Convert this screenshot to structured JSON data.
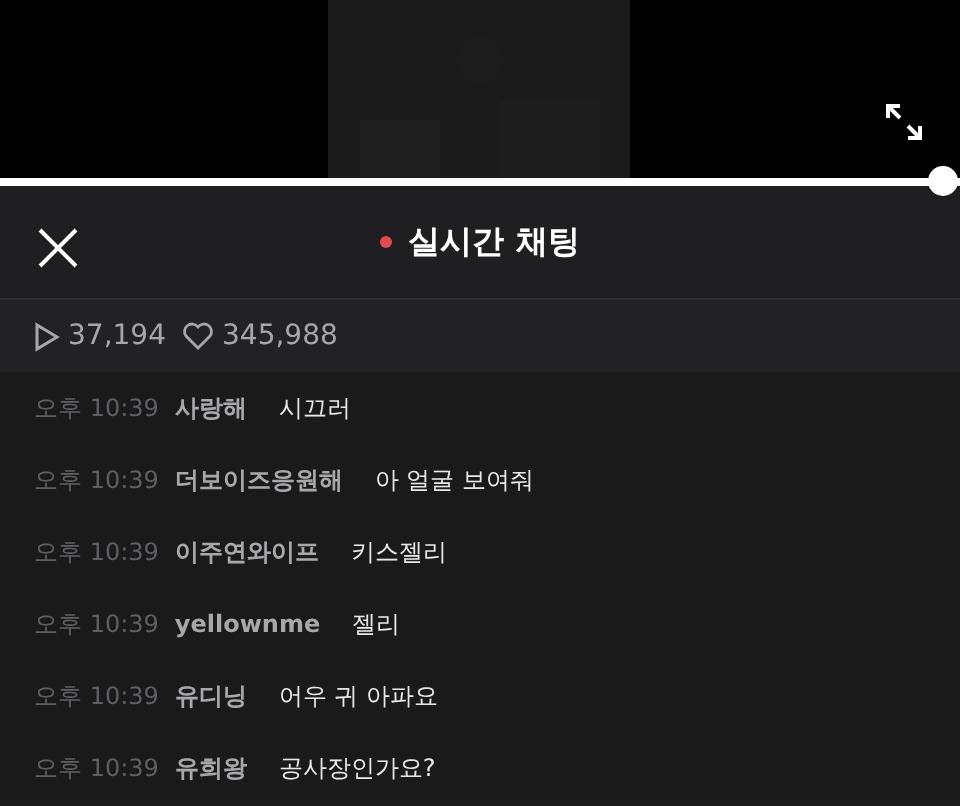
{
  "player": {
    "progress": {
      "level": 1
    }
  },
  "header": {
    "title": "실시간 채팅",
    "live": true
  },
  "stats": {
    "plays": "37,194",
    "likes": "345,988"
  },
  "messages": [
    {
      "time": "오후 10:39",
      "user": "사랑해",
      "text": "시끄러"
    },
    {
      "time": "오후 10:39",
      "user": "더보이즈응원해",
      "text": "아 얼굴 보여줘"
    },
    {
      "time": "오후 10:39",
      "user": "이주연와이프",
      "text": "키스젤리"
    },
    {
      "time": "오후 10:39",
      "user": "yellownme",
      "text": "젤리"
    },
    {
      "time": "오후 10:39",
      "user": "유디닝",
      "text": "어우 귀 아파요"
    },
    {
      "time": "오후 10:39",
      "user": "유희왕",
      "text": "공사장인가요?"
    }
  ]
}
